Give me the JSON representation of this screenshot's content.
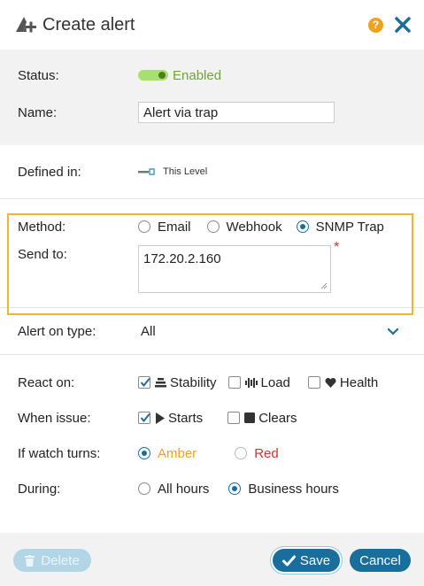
{
  "dialog": {
    "title": "Create alert",
    "help_label": "?",
    "title_icon": "add-alert-icon",
    "help_icon": "help-icon",
    "close_icon": "close-icon"
  },
  "status": {
    "label": "Status:",
    "value": "Enabled",
    "enabled": true
  },
  "name": {
    "label": "Name:",
    "value": "Alert via trap"
  },
  "defined_in": {
    "label": "Defined in:",
    "value": "This Level",
    "icon": "level-icon"
  },
  "method": {
    "label": "Method:",
    "options": [
      "Email",
      "Webhook",
      "SNMP Trap"
    ],
    "selected": "SNMP Trap"
  },
  "send_to": {
    "label": "Send to:",
    "value": "172.20.2.160",
    "required_mark": "*"
  },
  "alert_on_type": {
    "label": "Alert on type:",
    "value": "All",
    "icon": "chevron-down-icon"
  },
  "react_on": {
    "label": "React on:",
    "options": [
      {
        "label": "Stability",
        "checked": true,
        "icon": "stability-icon"
      },
      {
        "label": "Load",
        "checked": false,
        "icon": "load-icon"
      },
      {
        "label": "Health",
        "checked": false,
        "icon": "heart-icon"
      }
    ]
  },
  "when_issue": {
    "label": "When issue:",
    "options": [
      {
        "label": "Starts",
        "checked": true,
        "icon": "play-icon"
      },
      {
        "label": "Clears",
        "checked": false,
        "icon": "stop-icon"
      }
    ]
  },
  "watch_turns": {
    "label": "If watch turns:",
    "options": [
      {
        "label": "Amber",
        "selected": true,
        "color": "#f0a21b"
      },
      {
        "label": "Red",
        "selected": false,
        "color": "#d9302c"
      }
    ]
  },
  "during": {
    "label": "During:",
    "options": [
      "All hours",
      "Business hours"
    ],
    "selected": "Business hours"
  },
  "footer": {
    "delete_label": "Delete",
    "delete_icon": "trash-icon",
    "save_label": "Save",
    "save_icon": "checkmark-icon",
    "cancel_label": "Cancel"
  },
  "colors": {
    "accent": "#1a6e9c",
    "highlight_border": "#f1b530",
    "enabled_green": "#6ea43a"
  }
}
